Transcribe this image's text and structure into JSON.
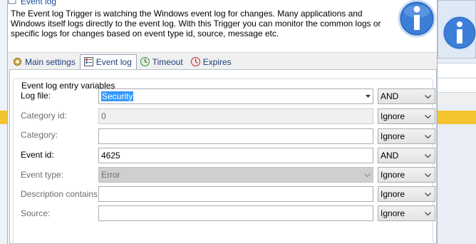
{
  "dialog": {
    "title": "Event log",
    "description": "The Event log Trigger is watching the Windows event log for changes. Many applications and Windows itself logs directly to the event log. With this Trigger you can monitor the common logs or specific logs for changes based on event type id, source, message etc."
  },
  "tabs": [
    {
      "label": "Main settings",
      "icon": "settings-icon",
      "active": false
    },
    {
      "label": "Event log",
      "icon": "event-log-icon",
      "active": true
    },
    {
      "label": "Timeout",
      "icon": "timeout-icon",
      "active": false
    },
    {
      "label": "Expires",
      "icon": "expires-icon",
      "active": false
    }
  ],
  "group": {
    "title": "Event log entry variables"
  },
  "rows": [
    {
      "label": "Log file:",
      "value": "Security",
      "selected": true,
      "type": "combo",
      "operator": "AND",
      "enabled": true
    },
    {
      "label": "Category id:",
      "value": "0",
      "type": "text",
      "operator": "Ignore",
      "enabled": false
    },
    {
      "label": "Category:",
      "value": "",
      "type": "text",
      "operator": "Ignore",
      "enabled": false
    },
    {
      "label": "Event id:",
      "value": "4625",
      "type": "text",
      "operator": "AND",
      "enabled": true
    },
    {
      "label": "Event type:",
      "value": "Error",
      "type": "combo",
      "operator": "Ignore",
      "enabled": false
    },
    {
      "label": "Description contains:",
      "value": "",
      "type": "text",
      "operator": "Ignore",
      "enabled": false
    },
    {
      "label": "Source:",
      "value": "",
      "type": "text",
      "operator": "Ignore",
      "enabled": false
    }
  ],
  "colors": {
    "accent": "#1e3f7a",
    "selection": "#3399ff",
    "background_highlight": "#f4c430"
  }
}
